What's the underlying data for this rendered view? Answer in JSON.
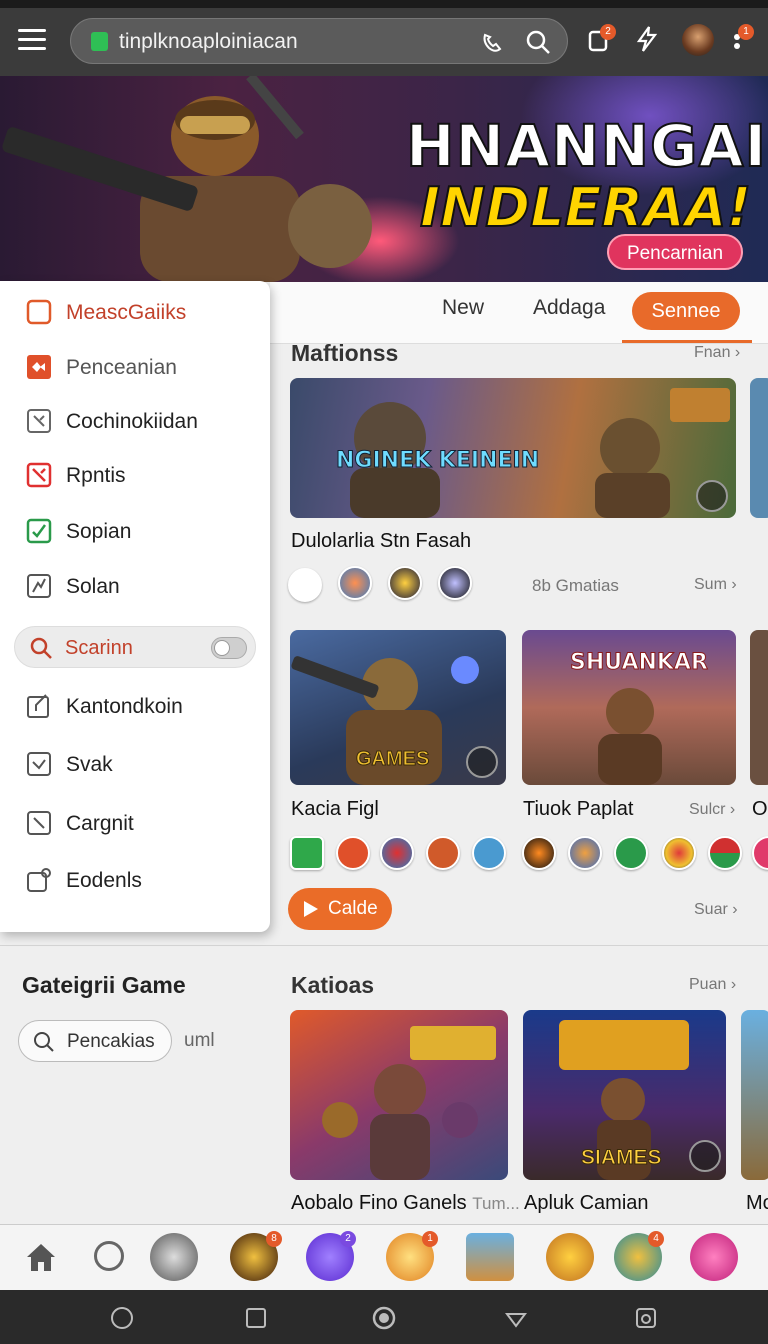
{
  "browser": {
    "url": "tinplknoaploiniacan",
    "badges": {
      "notifications": "2",
      "profile": "1"
    }
  },
  "hero": {
    "title_line1": "HNANNGAI",
    "title_line2": "INDLERAA!",
    "button_label": "Pencarnian"
  },
  "tabs": {
    "items": [
      "New",
      "Addaga"
    ],
    "active": "Sennee"
  },
  "side_menu": {
    "items": [
      "MeascGaiiks",
      "Penceanian",
      "Cochinokiidan",
      "Rpntis",
      "Sopian",
      "Solan"
    ],
    "search_label": "Scarinn",
    "items_after": [
      "Kantondkoin",
      "Svak",
      "Cargnit",
      "Eodenls"
    ],
    "colors": {
      "active": "#c2412a",
      "accent": "#e86a2a"
    }
  },
  "section1": {
    "title": "Maftionss",
    "more": "Fnan",
    "card_text": "NGINEK KEINEIN",
    "card_label": "Dulolarlia Stn Fasah",
    "count": "8b Gmatias",
    "sum": "Sum"
  },
  "section2": {
    "card1_text": "GAMES",
    "card1_label": "Kacia Figl",
    "card2_text": "SHUANKAR",
    "card2_label": "Tiuok Paplat",
    "more": "Sulcr",
    "play_label": "Calde",
    "more2": "Suar",
    "partial": "O"
  },
  "category": {
    "title": "Gateigrii Game",
    "search_label": "Pencakias",
    "extra": "uml"
  },
  "section3": {
    "title": "Katioas",
    "more": "Puan",
    "card1_label": "Aobalo Fino Ganels",
    "card1_sub": "Tum...",
    "card2_text": "SIAMES",
    "card2_label": "Apluk Camian",
    "partial": "Mo"
  },
  "app_badges": [
    "8",
    "2",
    "1",
    "4"
  ]
}
